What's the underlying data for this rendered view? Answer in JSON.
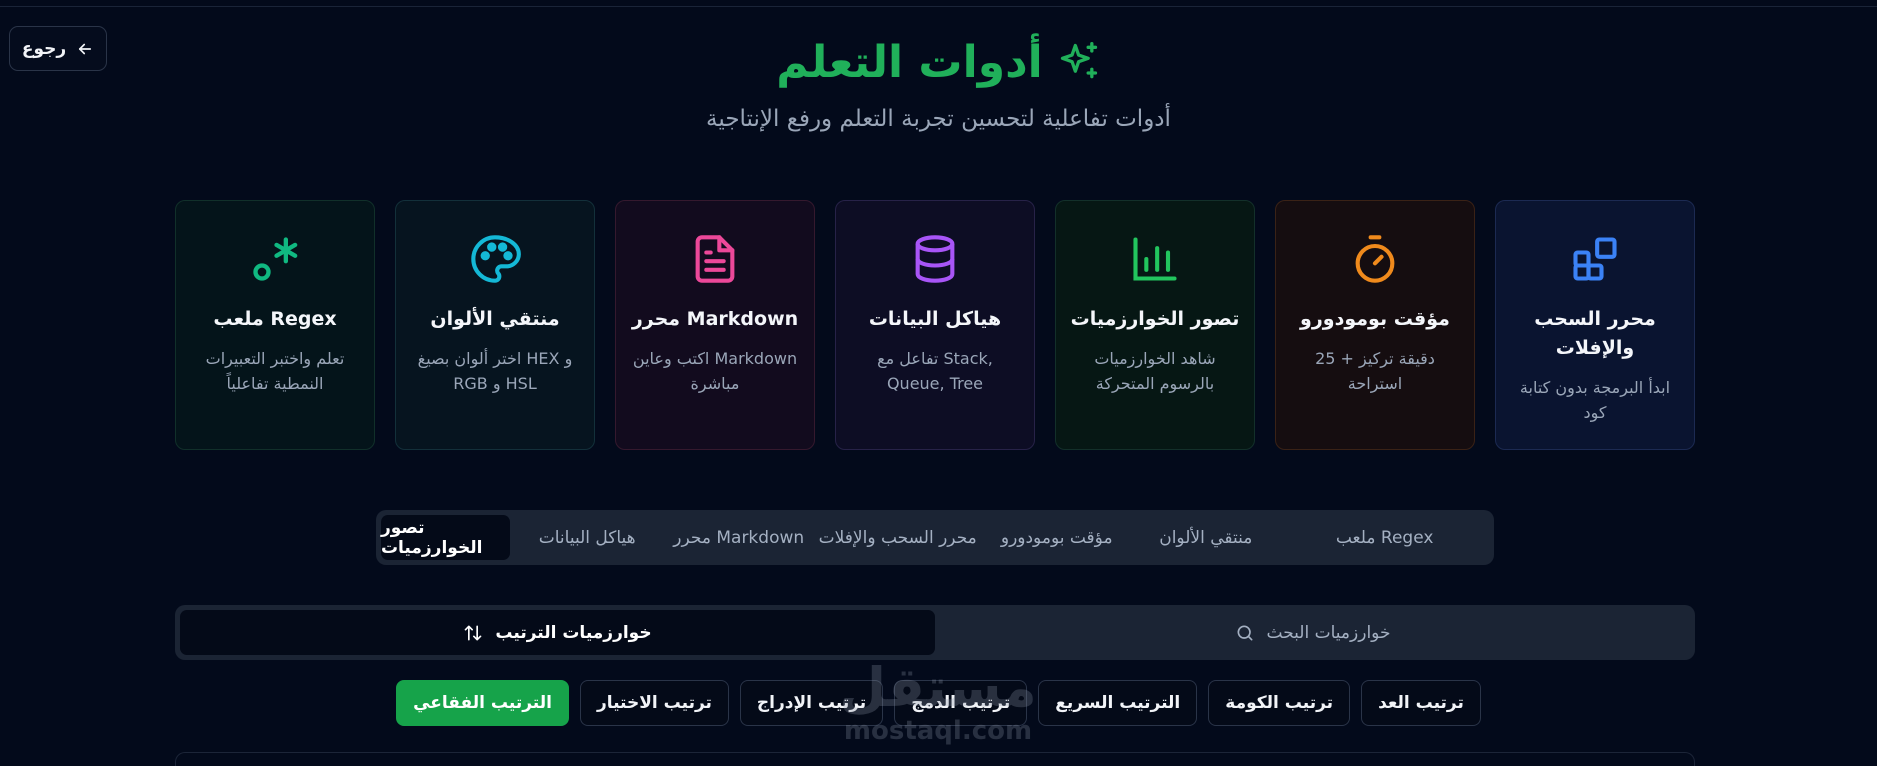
{
  "header": {
    "back_label": "رجوع",
    "title": "أدوات التعلم",
    "subtitle": "أدوات تفاعلية لتحسين تجربة التعلم ورفع الإنتاجية"
  },
  "cards": [
    {
      "name": "محرر السحب والإفلات",
      "desc": "ابدأ البرمجة بدون كتابة كود",
      "icon": "blocks-icon",
      "color": "#3b82f6"
    },
    {
      "name": "مؤقت بومودورو",
      "desc": "25 دقيقة تركيز + استراحة",
      "icon": "timer-icon",
      "color": "#f08a1c"
    },
    {
      "name": "تصور الخوارزميات",
      "desc": "شاهد الخوارزميات بالرسوم المتحركة",
      "icon": "bar-chart-icon",
      "color": "#22c55e"
    },
    {
      "name": "هياكل البيانات",
      "desc": "تفاعل مع Stack, Queue, Tree",
      "icon": "database-icon",
      "color": "#a855f7"
    },
    {
      "name": "محرر Markdown",
      "desc": "اكتب وعاين Markdown مباشرة",
      "icon": "file-text-icon",
      "color": "#ec4899"
    },
    {
      "name": "منتقي الألوان",
      "desc": "اختر ألوان بصيغ HEX و RGB و HSL",
      "icon": "palette-icon",
      "color": "#14b8d6"
    },
    {
      "name": "ملعب Regex",
      "desc": "تعلم واختبر التعبيرات النمطية تفاعلياً",
      "icon": "regex-icon",
      "color": "#10b981"
    }
  ],
  "tabs": [
    {
      "label": "ملعب Regex",
      "active": false
    },
    {
      "label": "منتقي الألوان",
      "active": false
    },
    {
      "label": "مؤقت بومودورو",
      "active": false
    },
    {
      "label": "محرر السحب والإفلات",
      "active": false
    },
    {
      "label": "محرر Markdown",
      "active": false
    },
    {
      "label": "هياكل البيانات",
      "active": false
    },
    {
      "label": "تصور الخوارزميات",
      "active": true
    }
  ],
  "segments": {
    "sorting": {
      "label": "خوارزميات الترتيب",
      "icon": "sort-arrows-icon",
      "active": true
    },
    "searching": {
      "label": "خوارزميات البحث",
      "icon": "search-icon",
      "active": false
    }
  },
  "algorithms": [
    {
      "label": "الترتيب الفقاعي",
      "active": true
    },
    {
      "label": "ترتيب الاختيار",
      "active": false
    },
    {
      "label": "ترتيب الإدراج",
      "active": false
    },
    {
      "label": "ترتيب الدمج",
      "active": false
    },
    {
      "label": "الترتيب السريع",
      "active": false
    },
    {
      "label": "ترتيب الكومة",
      "active": false
    },
    {
      "label": "ترتيب العد",
      "active": false
    }
  ],
  "watermark": {
    "arabic": "مستقل",
    "latin": "mostaql.com"
  },
  "colors": {
    "accent": "#20b05a",
    "background": "#030a1b",
    "active_algo": "#16a34a"
  }
}
